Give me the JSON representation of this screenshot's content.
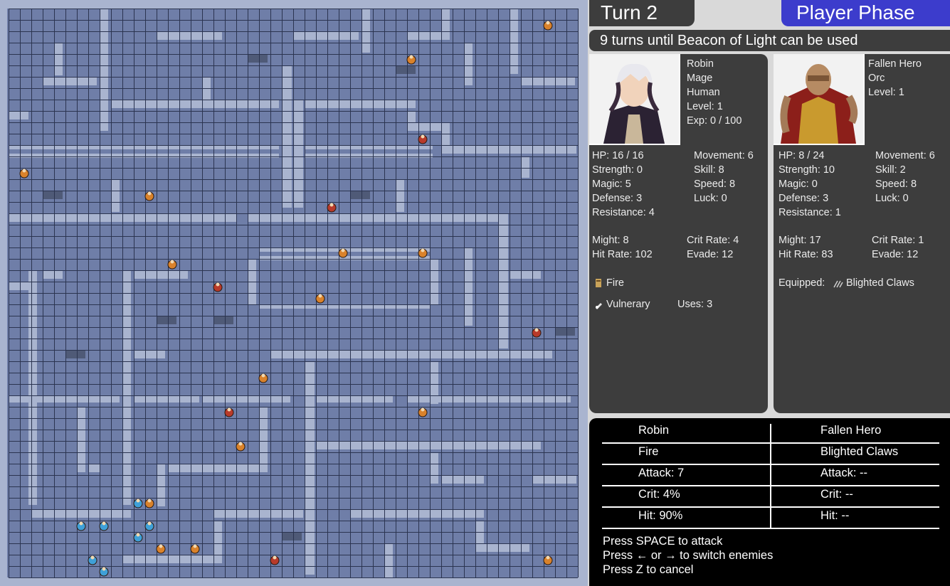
{
  "header": {
    "turn_label": "Turn 2",
    "phase_label": "Player Phase",
    "phase_color": "#3c3ccc",
    "beacon_message": "9 turns until Beacon of Light can be used"
  },
  "player": {
    "portrait_icon": "robin-portrait",
    "info": [
      "Robin",
      "Mage",
      "Human",
      "Level: 1",
      "Exp: 0 / 100"
    ],
    "stats_left": [
      "HP: 16 / 16",
      "Strength: 0",
      "Magic: 5",
      "Defense: 3",
      "Resistance: 4"
    ],
    "stats_right": [
      "Movement: 6",
      "Skill: 8",
      "Speed: 8",
      "Luck: 0"
    ],
    "combat_left": [
      "Might: 8",
      "Hit Rate: 102"
    ],
    "combat_right": [
      "Crit Rate: 4",
      "Evade: 12"
    ],
    "weapon": "Fire",
    "weapon_icon": "spell-tome-icon",
    "item": "Vulnerary",
    "item_icon": "potion-icon",
    "item_uses": "Uses: 3"
  },
  "enemy": {
    "portrait_icon": "fallen-hero-portrait",
    "info": [
      "Fallen Hero",
      "Orc",
      "Level: 1"
    ],
    "stats_left": [
      "HP: 8 / 24",
      "Strength: 10",
      "Magic: 0",
      "Defense: 3",
      "Resistance: 1"
    ],
    "stats_right": [
      "Movement: 6",
      "Skill: 2",
      "Speed: 8",
      "Luck: 0"
    ],
    "combat_left": [
      "Might: 17",
      "Hit Rate: 83"
    ],
    "combat_right": [
      "Crit Rate: 1",
      "Evade: 12"
    ],
    "equipped_label": "Equipped:",
    "equipped_icon": "claws-icon",
    "equipped_weapon": "Blighted Claws"
  },
  "forecast": {
    "rows": [
      [
        "Robin",
        "Fallen Hero"
      ],
      [
        "Fire",
        "Blighted Claws"
      ],
      [
        "Attack: 7",
        "Attack: --"
      ],
      [
        "Crit: 4%",
        "Crit: --"
      ],
      [
        "Hit: 90%",
        "Hit: --"
      ]
    ]
  },
  "controls": [
    "Press SPACE to attack",
    "Press ← or → to switch enemies",
    "Press Z to cancel"
  ],
  "map_colors": {
    "floor": "#6f7ea8",
    "grid": "#2b3450",
    "wall": "#a9b4cf",
    "wall_dark": "#4f5a77",
    "enemy_unit": "#d9822b",
    "enemy_unit_alt": "#b83a2a",
    "ally_unit": "#3fa0d8"
  }
}
